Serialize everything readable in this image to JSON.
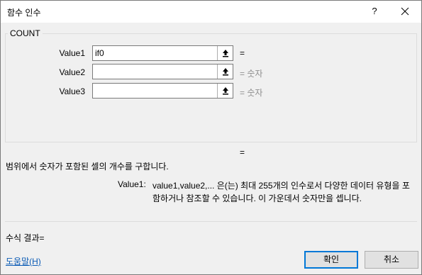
{
  "dialog": {
    "title": "함수 인수",
    "help_glyph": "?",
    "close_glyph": "✕"
  },
  "function": {
    "name": "COUNT",
    "args": [
      {
        "label": "Value1",
        "value": "if0",
        "result": "="
      },
      {
        "label": "Value2",
        "value": "",
        "result": "= 숫자"
      },
      {
        "label": "Value3",
        "value": "",
        "result": "= 숫자"
      }
    ],
    "result_eq": "=",
    "description": "범위에서 숫자가 포함된 셀의 개수를 구합니다.",
    "param_name": "Value1:",
    "param_description": "value1,value2,... 은(는) 최대 255개의 인수로서 다양한 데이터 유형을 포함하거나 참조할 수 있습니다. 이 가운데서 숫자만을 셉니다."
  },
  "footer": {
    "formula_result": "수식 결과=",
    "help_link": "도움말(H)",
    "ok_label": "확인",
    "cancel_label": "취소"
  },
  "icons": {
    "collapse": "collapse-dialog-icon"
  }
}
